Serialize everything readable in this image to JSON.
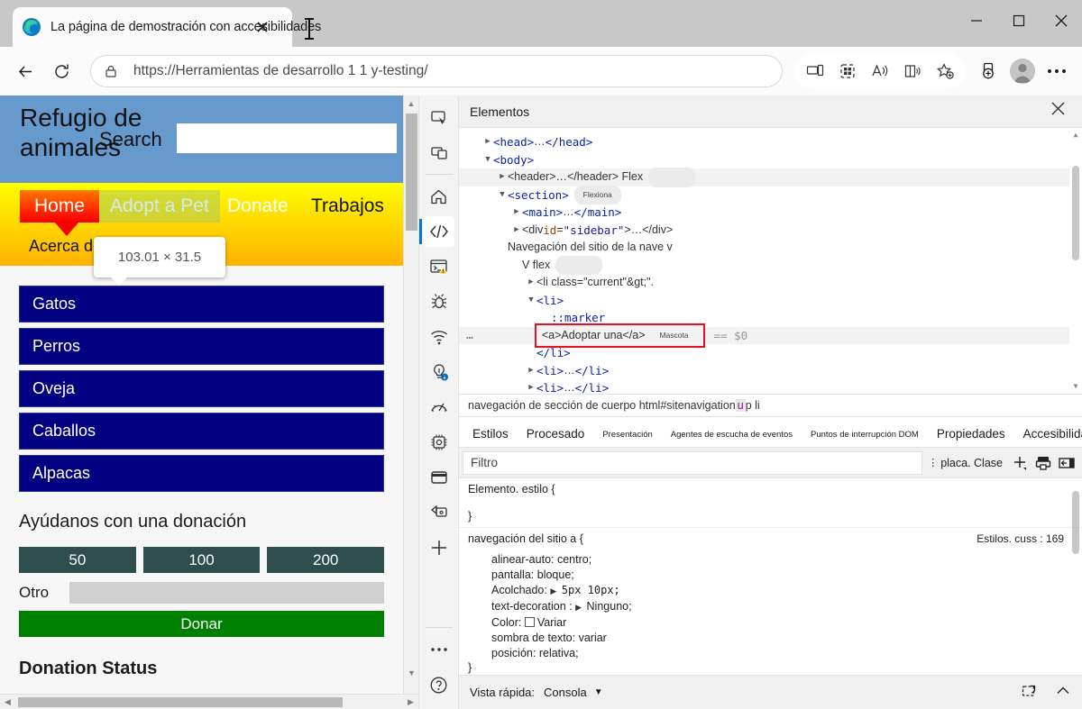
{
  "browser": {
    "tab": {
      "title": "La página de demostración con accesibilidades",
      "favicon": "edge-logo-icon",
      "close": "×"
    },
    "address": {
      "url": "https://Herramientas de desarrollo 1 1 y-testing/",
      "lock_icon": "lock-icon"
    },
    "nav_icons": {
      "back": "back-arrow-icon",
      "reload": "reload-icon"
    },
    "toolbar_icons": [
      "device-cast-icon",
      "collections-grid-icon",
      "read-aloud-icon",
      "immersive-reader-icon",
      "add-favorite-icon",
      "split-screen-icon",
      "profile-avatar-icon",
      "more-settings-icon"
    ],
    "window_controls": {
      "minimize": "minimize-icon",
      "maximize": "maximize-icon",
      "close": "close-icon"
    }
  },
  "page": {
    "site_title": "Refugio de animales",
    "search_label": "Search",
    "search_value": "",
    "size_tooltip": "103.01 × 31.5",
    "nav": {
      "home": "Home",
      "adopt": "Adopt a Pet",
      "donate": "Donate",
      "jobs": "Trabajos",
      "about": "Acerca de nosotros"
    },
    "categories": [
      "Gatos",
      "Perros",
      "Oveja",
      "Caballos",
      "Alpacas"
    ],
    "donation": {
      "title": "Ayúdanos con una donación",
      "amounts": [
        "50",
        "100",
        "200"
      ],
      "other_label": "Otro",
      "other_value": "",
      "submit": "Donar"
    },
    "next_section_title": "Donation Status"
  },
  "devtools": {
    "rail": [
      "inspect-element-icon",
      "device-emulation-icon",
      "welcome-home-icon",
      "elements-code-icon",
      "console-warning-icon",
      "debugger-bug-icon",
      "network-wifi-icon",
      "issues-lightbulb-icon",
      "performance-gauge-icon",
      "memory-chip-icon",
      "application-window-icon",
      "sources-paint-icon",
      "more-tools-add-icon",
      "more-options-icon",
      "help-icon"
    ],
    "panel_title": "Elementos",
    "close_label": "✕",
    "dom": [
      {
        "indent": 1,
        "twisty": "▶",
        "parts": [
          {
            "t": "tagb",
            "v": "<head>"
          },
          {
            "t": "txt",
            "v": "…"
          },
          {
            "t": "tagb",
            "v": "</head>"
          }
        ]
      },
      {
        "indent": 1,
        "twisty": "▼",
        "parts": [
          {
            "t": "tagb",
            "v": "<body>"
          }
        ]
      },
      {
        "indent": 2,
        "twisty": "▶",
        "hl": true,
        "parts": [
          {
            "t": "txt",
            "v": "<header>…</header> Flex"
          }
        ],
        "badge": ""
      },
      {
        "indent": 2,
        "twisty": "▼",
        "parts": [
          {
            "t": "tagb",
            "v": "<section>"
          }
        ],
        "badge": "Flexiona"
      },
      {
        "indent": 3,
        "twisty": "▶",
        "parts": [
          {
            "t": "tagb",
            "v": "<main>"
          },
          {
            "t": "txt",
            "v": "…"
          },
          {
            "t": "tagb",
            "v": "</main>"
          }
        ]
      },
      {
        "indent": 3,
        "twisty": "▶",
        "parts": [
          {
            "t": "txt",
            "v": "<div"
          },
          {
            "t": "attr",
            "v": "  id"
          },
          {
            "t": "txt",
            "v": "="
          },
          {
            "t": "val",
            "v": "\"sidebar\""
          },
          {
            "t": "txt",
            "v": ">…</div>"
          }
        ]
      },
      {
        "indent": 2,
        "twisty": "",
        "parts": [
          {
            "t": "txt",
            "v": "Navegación del sitio de la nave v"
          }
        ]
      },
      {
        "indent": 3,
        "twisty": "",
        "parts": [
          {
            "t": "txt",
            "v": "V flex"
          }
        ],
        "badge": ""
      },
      {
        "indent": 4,
        "twisty": "▶",
        "parts": [
          {
            "t": "txt",
            "v": "<li class=\"current\"&gt;\"."
          }
        ]
      },
      {
        "indent": 4,
        "twisty": "▼",
        "parts": [
          {
            "t": "tagb",
            "v": "<li>"
          }
        ]
      },
      {
        "indent": 5,
        "twisty": "",
        "parts": [
          {
            "t": "marker",
            "v": "::marker"
          }
        ]
      },
      {
        "indent": 0,
        "twisty": "",
        "selected": true,
        "dots": "…",
        "sel_text": "<a>Adoptar una</a>",
        "sel_badge": "Mascota",
        "dollar": "== $0"
      },
      {
        "indent": 4,
        "twisty": "",
        "parts": [
          {
            "t": "tagb",
            "v": "</li>"
          }
        ]
      },
      {
        "indent": 4,
        "twisty": "▶",
        "parts": [
          {
            "t": "tagb",
            "v": "<li>"
          },
          {
            "t": "txt",
            "v": "…"
          },
          {
            "t": "tagb",
            "v": "</li>"
          }
        ]
      },
      {
        "indent": 4,
        "twisty": "▶",
        "parts": [
          {
            "t": "tagb",
            "v": "<li>"
          },
          {
            "t": "txt",
            "v": "…"
          },
          {
            "t": "tagb",
            "v": "</li>"
          }
        ]
      },
      {
        "indent": 4,
        "twisty": "▶",
        "parts": [
          {
            "t": "tagb",
            "v": "<li>"
          },
          {
            "t": "txt",
            "v": "…"
          },
          {
            "t": "tagb",
            "v": "</li>"
          }
        ]
      }
    ],
    "breadcrumb": {
      "prefix": "navegación de sección de cuerpo html#sitenavigation ",
      "selected": "u",
      "suffix": "p li"
    },
    "style_tabs": [
      {
        "label": "Estilos",
        "selected": true,
        "small": false
      },
      {
        "label": "Procesado",
        "selected": false,
        "small": false
      },
      {
        "label": "Presentación",
        "selected": false,
        "small": true
      },
      {
        "label": "Agentes de escucha de eventos",
        "selected": false,
        "small": true
      },
      {
        "label": "Puntos de interrupción DOM",
        "selected": false,
        "small": true
      },
      {
        "label": "Propiedades",
        "selected": false,
        "small": false
      },
      {
        "label": "Accesibilidad",
        "selected": false,
        "small": false
      }
    ],
    "filter": {
      "placeholder": "Filtro",
      "value": "",
      "cls_label": "placa. Clase",
      "add_icon": "add-rule-icon",
      "print_icon": "print-styles-icon",
      "toggle_icon": "toggle-sidebar-icon"
    },
    "styles": {
      "rule1_selector": "Elemento. estilo {",
      "rule1_close": "}",
      "rule2_selector": "navegación del sitio a {",
      "rule2_source": "Estilos. cuss : 169",
      "rule2_props": [
        {
          "name": "alinear-auto",
          "value": "centro;",
          "tri": false
        },
        {
          "name": "pantalla",
          "value": "bloque;",
          "tri": false
        },
        {
          "name": "Acolchado",
          "value": "5px  10px;",
          "tri": true,
          "mono": true
        },
        {
          "name": "text-decoration ",
          "value": "Ninguno;",
          "tri": true
        },
        {
          "name": "Color",
          "value": "Variar",
          "checkbox": true
        },
        {
          "name": "sombra de texto",
          "value": "variar",
          "tri": false
        },
        {
          "name": "posición",
          "value": "relativa;",
          "tri": false
        }
      ],
      "rule2_close": "}"
    },
    "quickview": {
      "label": "Vista rápida:",
      "value": "Consola",
      "caret": "▼",
      "new_console_icon": "new-console-icon",
      "collapse_icon": "collapse-icon"
    }
  },
  "colors": {
    "accent": "#0078d4",
    "header_blue": "#6699cc",
    "nav_yellow": "#ffe000",
    "category_blue": "#000080",
    "donate_green": "#008000",
    "selection_red": "#e81123"
  }
}
